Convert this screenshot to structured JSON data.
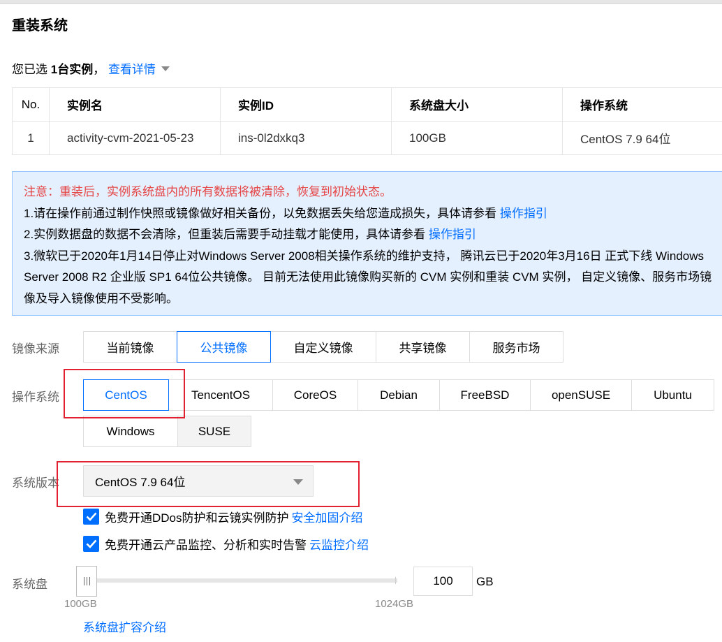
{
  "page": {
    "title": "重装系统"
  },
  "selection": {
    "prefix": "您已选",
    "count": "1台实例",
    "separator": "，",
    "details_link": "查看详情"
  },
  "instance_table": {
    "headers": [
      "No.",
      "实例名",
      "实例ID",
      "系统盘大小",
      "操作系统"
    ],
    "rows": [
      [
        "1",
        "activity-cvm-2021-05-23",
        "ins-0l2dxkq3",
        "100GB",
        "CentOS 7.9 64位"
      ]
    ]
  },
  "notice": {
    "warning": "注意：重装后，实例系统盘内的所有数据将被清除，恢复到初始状态。",
    "line1_text": "1.请在操作前通过制作快照或镜像做好相关备份，以免数据丢失给您造成损失，具体请参看",
    "line1_link": "操作指引",
    "line2_text": "2.实例数据盘的数据不会清除，但重装后需要手动挂载才能使用，具体请参看",
    "line2_link": "操作指引",
    "line3": "3.微软已于2020年1月14日停止对Windows Server 2008相关操作系统的维护支持， 腾讯云已于2020年3月16日 正式下线 Windows Server 2008 R2 企业版 SP1 64位公共镜像。 目前无法使用此镜像购买新的 CVM 实例和重装 CVM 实例， 自定义镜像、服务市场镜像及导入镜像使用不受影响。"
  },
  "image_source": {
    "label": "镜像来源",
    "options": [
      "当前镜像",
      "公共镜像",
      "自定义镜像",
      "共享镜像",
      "服务市场"
    ],
    "selected": "公共镜像"
  },
  "os": {
    "label": "操作系统",
    "options": [
      "CentOS",
      "TencentOS",
      "CoreOS",
      "Debian",
      "FreeBSD",
      "openSUSE",
      "Ubuntu",
      "Windows",
      "SUSE"
    ],
    "selected": "CentOS"
  },
  "version": {
    "label": "系统版本",
    "value": "CentOS 7.9 64位"
  },
  "checks": [
    {
      "text": "免费开通DDos防护和云镜实例防护",
      "link": "安全加固介绍",
      "checked": true
    },
    {
      "text": "免费开通云产品监控、分析和实时告警",
      "link": "云监控介绍",
      "checked": true
    }
  ],
  "disk": {
    "label": "系统盘",
    "min_label": "100GB",
    "max_label": "1024GB",
    "value": "100",
    "unit": "GB",
    "slider_fraction": 0,
    "expand_link": "系统盘扩容介绍"
  },
  "colors": {
    "accent": "#006eff",
    "warning": "#e54545",
    "notice_bg": "#e5f0ff",
    "highlight_box": "#e1212f"
  }
}
